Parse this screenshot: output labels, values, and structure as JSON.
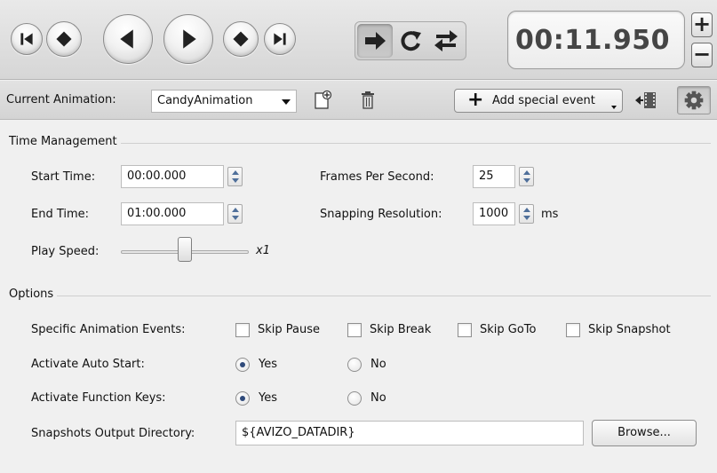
{
  "player": {
    "time_display": "00:11.950",
    "step_up_label": "+",
    "step_down_label": "−"
  },
  "toolbar": {
    "current_animation_label": "Current Animation:",
    "animation_selected": "CandyAnimation",
    "add_special_event_label": "Add special event",
    "add_plus": "+"
  },
  "time_management": {
    "title": "Time Management",
    "start_time_label": "Start Time:",
    "start_time_value": "00:00.000",
    "end_time_label": "End Time:",
    "end_time_value": "01:00.000",
    "play_speed_label": "Play Speed:",
    "play_speed_value": "x1",
    "play_speed_position": 0.5,
    "fps_label": "Frames Per Second:",
    "fps_value": "25",
    "snapping_label": "Snapping Resolution:",
    "snapping_value": "1000",
    "snapping_unit": "ms"
  },
  "options": {
    "title": "Options",
    "specific_events_label": "Specific Animation Events:",
    "events": [
      {
        "label": "Skip Pause",
        "checked": false
      },
      {
        "label": "Skip Break",
        "checked": false
      },
      {
        "label": "Skip GoTo",
        "checked": false
      },
      {
        "label": "Skip Snapshot",
        "checked": false
      }
    ],
    "auto_start_label": "Activate Auto Start:",
    "auto_start_yes": "Yes",
    "auto_start_no": "No",
    "auto_start_selected": "Yes",
    "function_keys_label": "Activate Function Keys:",
    "function_keys_yes": "Yes",
    "function_keys_no": "No",
    "function_keys_selected": "Yes",
    "snapshots_dir_label": "Snapshots Output Directory:",
    "snapshots_dir_value": "${AVIZO_DATADIR}",
    "browse_label": "Browse..."
  },
  "colors": {
    "icon_dark": "#222222",
    "spinner_arrow": "#4f6f9a",
    "radio_dot": "#2f4a7a"
  },
  "icons": [
    "go-to-start-icon",
    "previous-keyframe-icon",
    "play-backward-icon",
    "play-forward-icon",
    "next-keyframe-icon",
    "go-to-end-icon",
    "play-once-icon",
    "loop-icon",
    "swing-icon",
    "new-animation-icon",
    "delete-icon",
    "film-add-icon",
    "gear-icon"
  ]
}
